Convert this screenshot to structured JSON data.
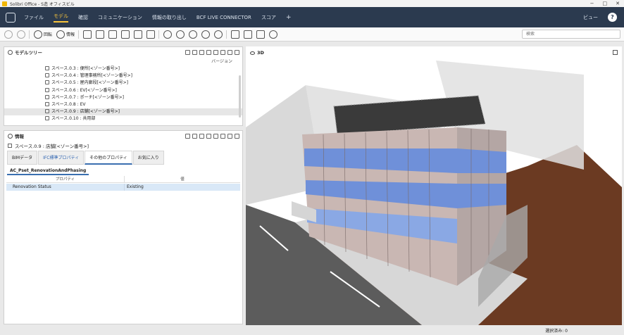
{
  "window": {
    "title": "Solibri Office - S造 オフィスビル",
    "controls": [
      "−",
      "□",
      "✕"
    ]
  },
  "menubar": {
    "items": [
      "ファイル",
      "モデル",
      "確認",
      "コミュニケーション",
      "情報の取り出し",
      "BCF LIVE CONNECTOR",
      "スコア"
    ],
    "active": "モデル",
    "plus": "+",
    "view_label": "ビュー",
    "help": "?"
  },
  "toolbar": {
    "rotate_label": "回転",
    "info_label": "情報",
    "search_placeholder": "検索"
  },
  "model_tree": {
    "title": "モデルツリー",
    "version_label": "バージョン",
    "rows": [
      "スペース.0.3 : 便所[<ゾーン番号>]",
      "スペース.0.4 : 管理事務所[<ゾーン番号>]",
      "スペース.0.5 : 屋内廊段[<ゾーン番号>]",
      "スペース.0.6 : EV[<ゾーン番号>]",
      "スペース.0.7 : ポーチ[<ゾーン番号>]",
      "スペース.0.8 : EV",
      "スペース.0.9 : 店舗[<ゾーン番号>]",
      "スペース.0.10 : 共用部"
    ],
    "selected_index": 6
  },
  "info": {
    "title": "情報",
    "selected_item": "スペース.0.9 : 店舗[<ゾーン番号>]",
    "tabs": [
      "BIMデータ",
      "IFC標準プロパティ",
      "その他のプロパティ",
      "お気に入り"
    ],
    "active_tab": "その他のプロパティ",
    "pset": "AC_Pset_RenovationAndPhasing",
    "col_property": "プロパティ",
    "col_value": "値",
    "row_property": "Renovation Status",
    "row_value": "Existing"
  },
  "view3d": {
    "title": "3D"
  },
  "status": {
    "selection": "選択済み: 0"
  }
}
